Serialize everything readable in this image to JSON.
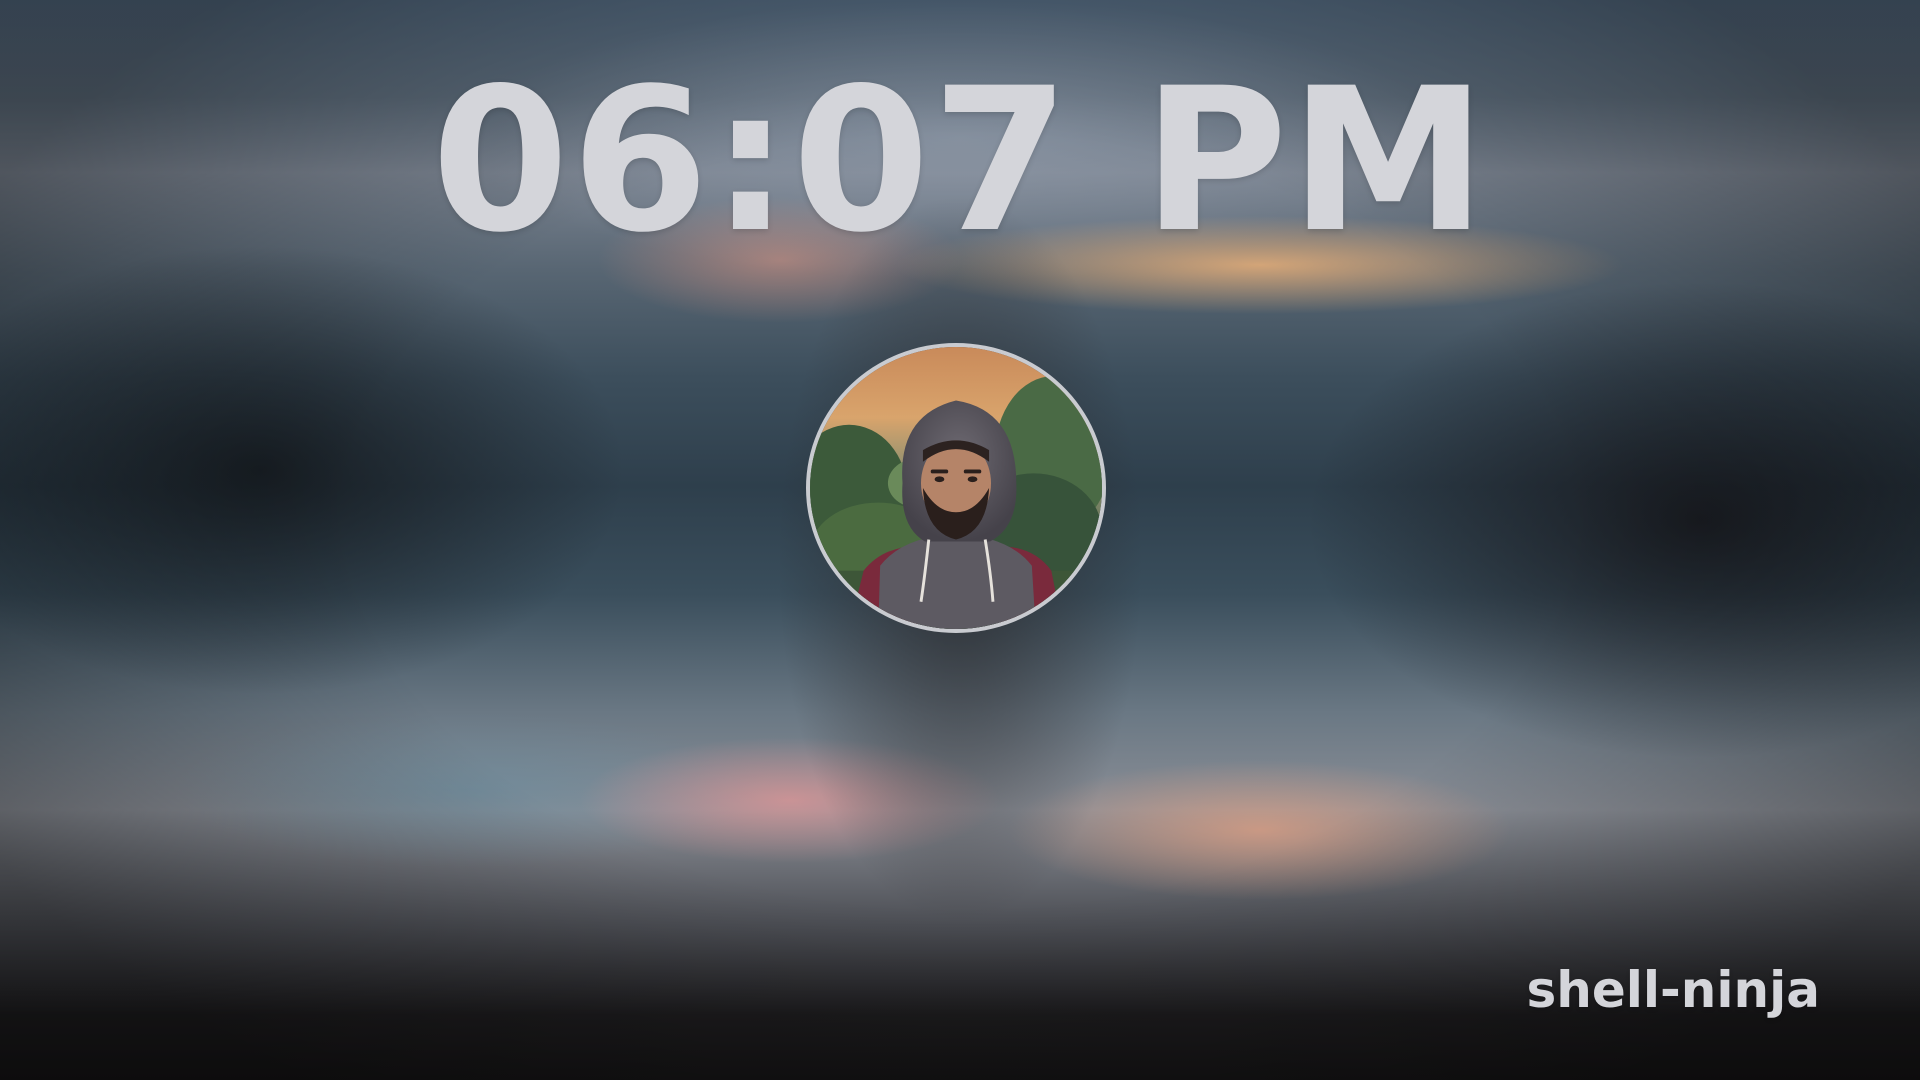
{
  "lockscreen": {
    "time": "06:07 PM",
    "username": "shell-ninja",
    "avatar_icon": "user-avatar-photo"
  },
  "colors": {
    "text": "#d4d5da",
    "avatar_ring": "#c9cbd0"
  }
}
